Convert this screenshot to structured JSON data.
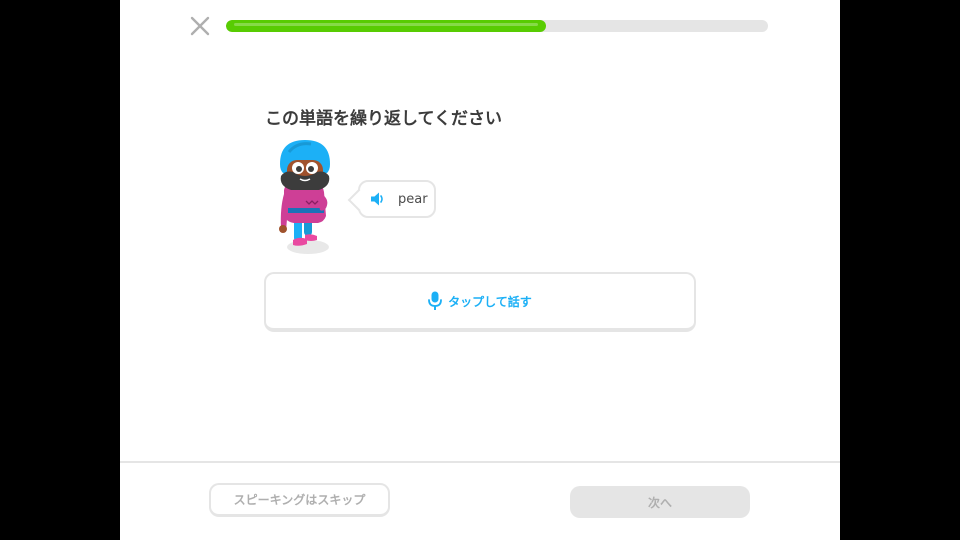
{
  "header": {
    "close_icon": "close-icon",
    "progress": {
      "value": 0.59,
      "color": "#58cc02",
      "track_color": "#e5e5e5"
    }
  },
  "challenge": {
    "prompt": "この単語を繰り返してください",
    "bubble": {
      "icon": "speaker-icon",
      "word": "pear"
    },
    "tap_button": {
      "icon": "microphone-icon",
      "label": "タップして話す",
      "color": "#1cb0f6"
    }
  },
  "footer": {
    "skip_label": "スピーキングはスキップ",
    "next_label": "次へ",
    "next_enabled": false
  }
}
